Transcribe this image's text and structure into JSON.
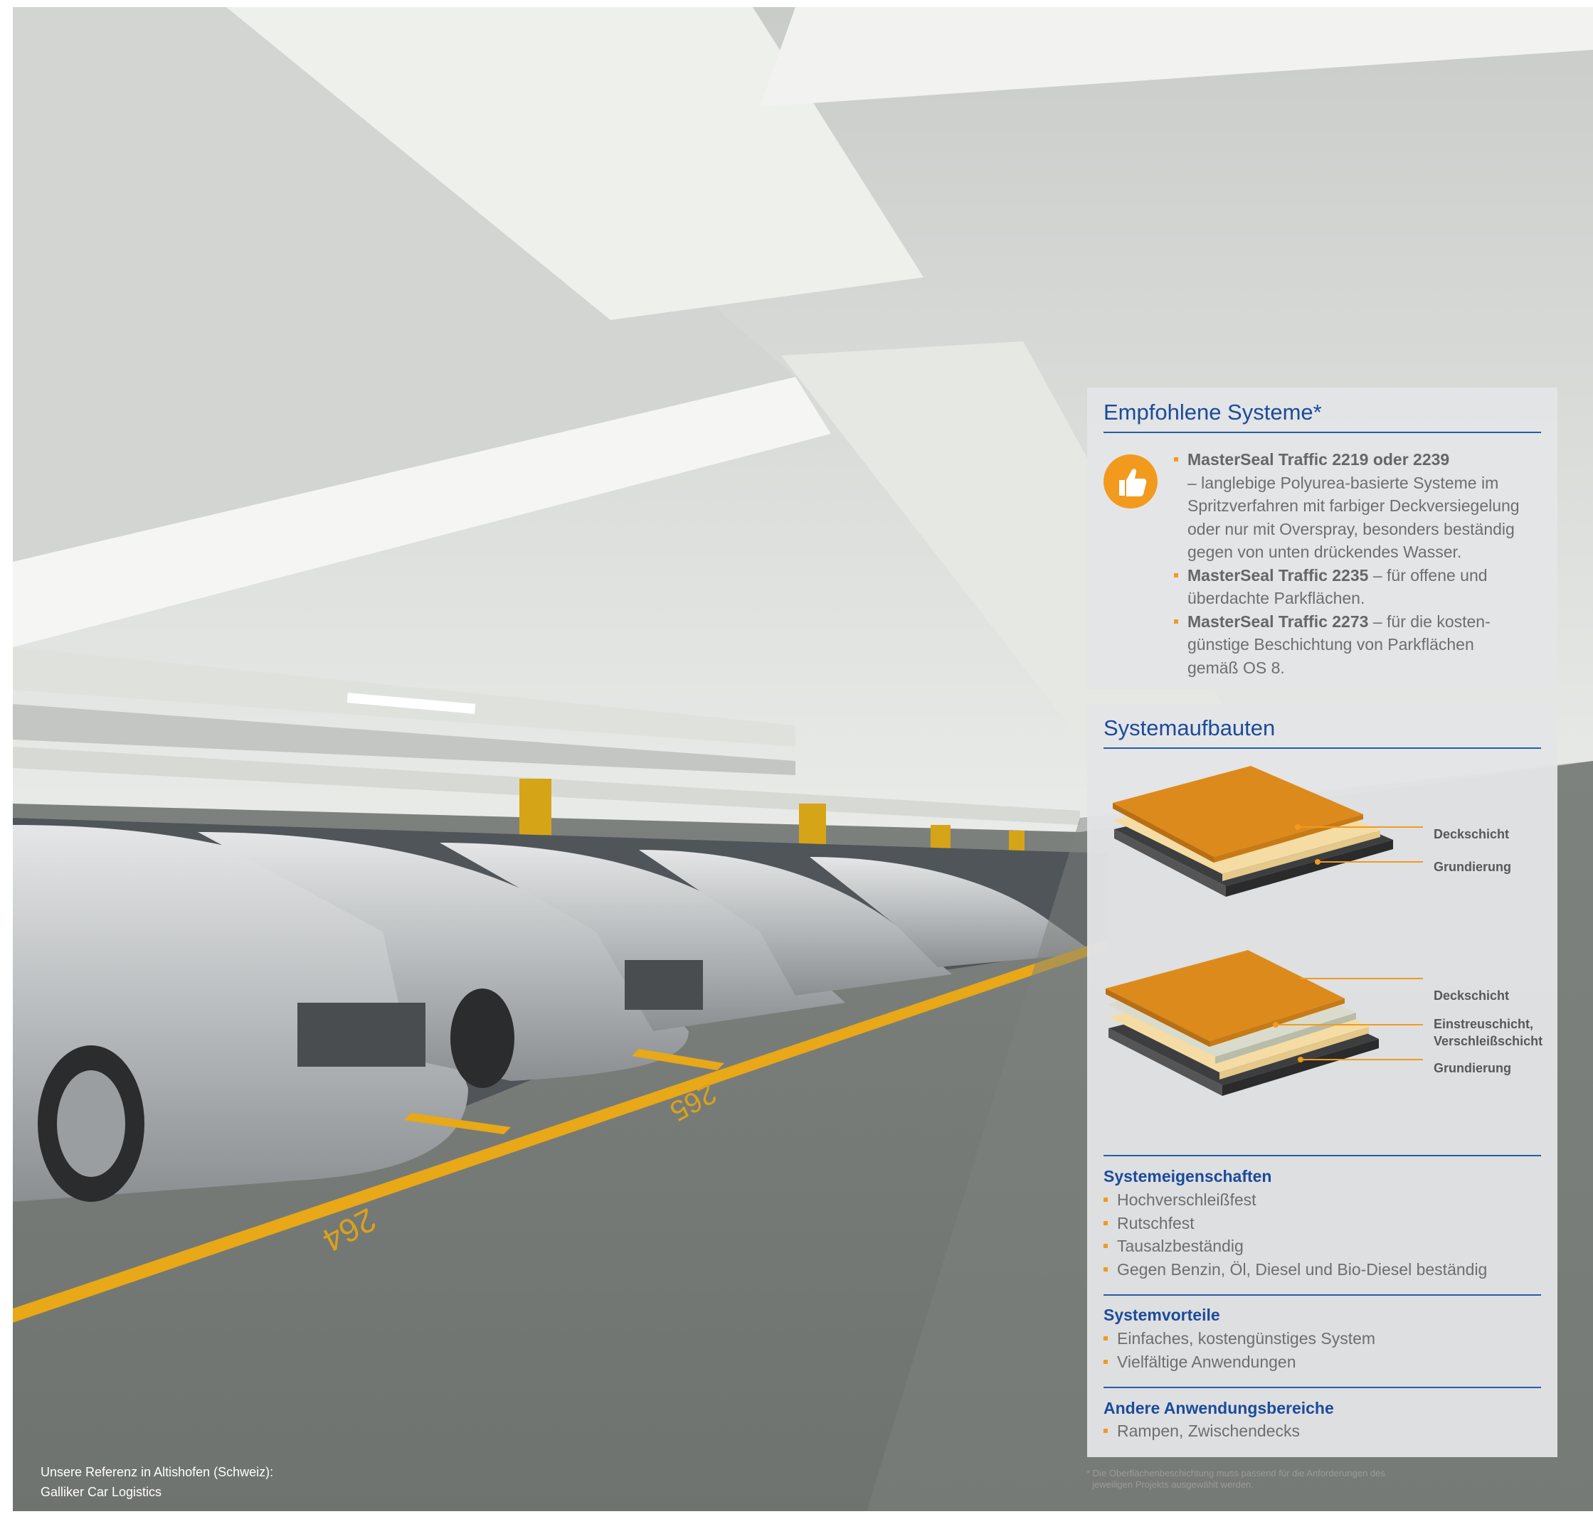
{
  "photo": {
    "caption_line1": "Unsere Referenz in Altishofen (Schweiz):",
    "caption_line2": "Galliker Car Logistics",
    "space_label_1": "264",
    "space_label_2": "265"
  },
  "recommended": {
    "title": "Empfohlene Systeme*",
    "icon": "thumbs-up-icon",
    "items": [
      {
        "name": "MasterSeal Traffic 2219 oder 2239",
        "lines": [
          "– langlebige Polyurea-basierte Systeme im",
          "Spritzverfahren mit farbiger Deckversiegelung",
          "oder nur mit Overspray, besonders beständig",
          "gegen von unten drückendes Wasser."
        ]
      },
      {
        "name": "MasterSeal Traffic 2235",
        "suffix": " – für offene und",
        "lines": [
          "überdachte Parkflächen."
        ]
      },
      {
        "name": "MasterSeal Traffic 2273",
        "suffix": " – für die kosten-",
        "lines": [
          "günstige Beschichtung von Parkflächen",
          "gemäß OS 8."
        ]
      }
    ]
  },
  "systems": {
    "title": "Systemaufbauten",
    "diagram1": [
      "Deckschicht",
      "Grundierung"
    ],
    "diagram2": [
      "Deckschicht",
      "Einstreuschicht,",
      "Verschleißschicht",
      "Grundierung"
    ],
    "properties_title": "Systemeigenschaften",
    "properties": [
      "Hochverschleißfest",
      "Rutschfest",
      "Tausalzbeständig",
      "Gegen Benzin, Öl, Diesel und Bio-Diesel beständig"
    ],
    "advantages_title": "Systemvorteile",
    "advantages": [
      "Einfaches, kostengünstiges System",
      "Vielfältige Anwendungen"
    ],
    "other_title": "Andere Anwendungsbereiche",
    "other": [
      "Rampen, Zwischendecks"
    ]
  },
  "footnote": {
    "line1": "* Die Oberflächenbeschichtung muss passend für die Anforderungen des",
    "line2": "jeweiligen Projekts ausgewählt werden."
  },
  "colors": {
    "accent_orange": "#f29a1e",
    "heading_blue": "#1b4b9a",
    "floor_line_yellow": "#e8a817"
  }
}
